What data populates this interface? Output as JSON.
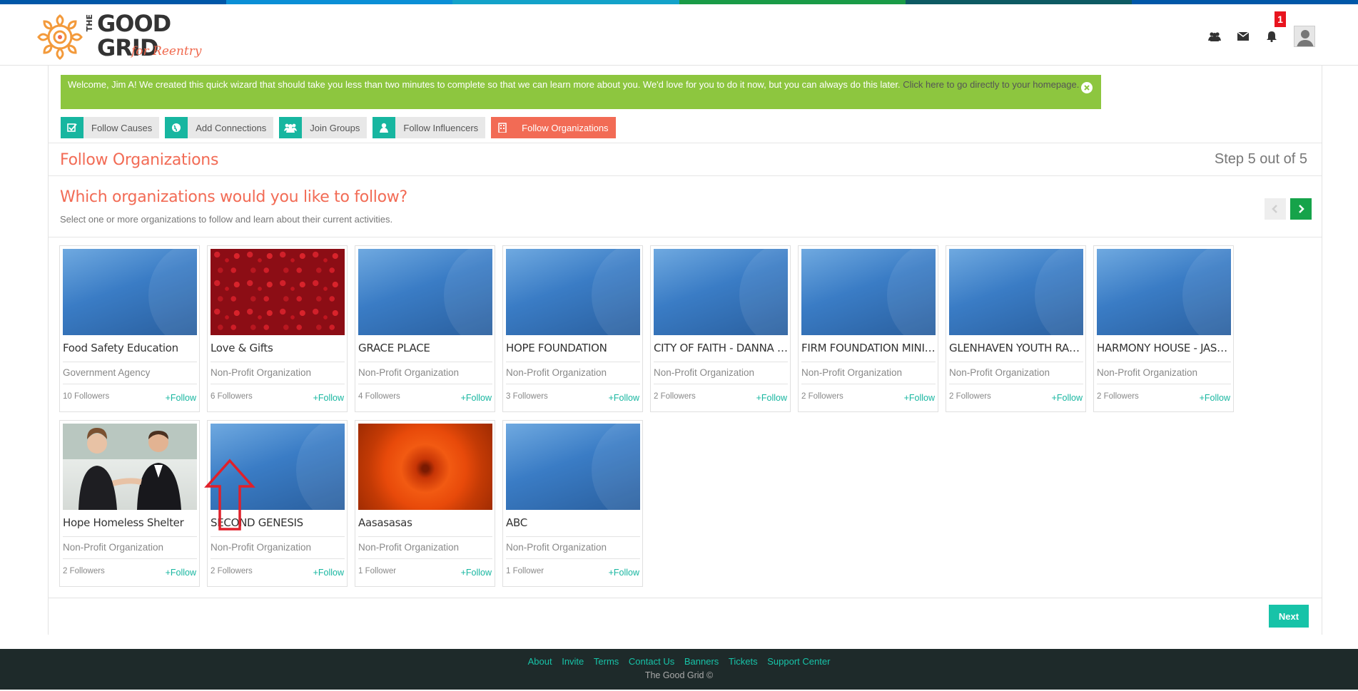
{
  "header": {
    "logo_the": "THE",
    "logo_line1": "GOOD",
    "logo_line2": "GRID",
    "logo_tagline": "for Reentry",
    "notification_count": "1",
    "stripe_colors": [
      "#0057a8",
      "#0a8fd6",
      "#13a2c9",
      "#1a9b47",
      "#0d5a63"
    ]
  },
  "welcome": {
    "message": "Welcome, Jim A! We created this quick wizard that should take you less than two minutes to complete so that we can learn more about you. We'd love for you to do it now, but you can always do this later.",
    "link_text": "Click here to go directly to your homepage."
  },
  "steps": [
    {
      "label": "Follow Causes",
      "icon": "checkbox-icon"
    },
    {
      "label": "Add Connections",
      "icon": "globe-icon"
    },
    {
      "label": "Join Groups",
      "icon": "users-icon"
    },
    {
      "label": "Follow Influencers",
      "icon": "user-icon"
    },
    {
      "label": "Follow Organizations",
      "icon": "building-icon"
    }
  ],
  "section": {
    "title": "Follow Organizations",
    "step_of": "Step 5 out of 5",
    "question": "Which organizations would you like to follow?",
    "subtitle": "Select one or more organizations to follow and learn about their current activities."
  },
  "organizations": [
    {
      "name": "Food Safety Education",
      "type": "Government Agency",
      "followers": "10 Followers",
      "follow": "+Follow"
    },
    {
      "name": "Love & Gifts",
      "type": "Non-Profit Organization",
      "followers": "6 Followers",
      "follow": "+Follow"
    },
    {
      "name": "GRACE PLACE",
      "type": "Non-Profit Organization",
      "followers": "4 Followers",
      "follow": "+Follow"
    },
    {
      "name": "HOPE FOUNDATION",
      "type": "Non-Profit Organization",
      "followers": "3 Followers",
      "follow": "+Follow"
    },
    {
      "name": "CITY OF FAITH - DANNA HO...",
      "type": "Non-Profit Organization",
      "followers": "2 Followers",
      "follow": "+Follow"
    },
    {
      "name": "FIRM FOUNDATION MINIST...",
      "type": "Non-Profit Organization",
      "followers": "2 Followers",
      "follow": "+Follow"
    },
    {
      "name": "GLENHAVEN YOUTH RANCH",
      "type": "Non-Profit Organization",
      "followers": "2 Followers",
      "follow": "+Follow"
    },
    {
      "name": "HARMONY HOUSE - JASPER",
      "type": "Non-Profit Organization",
      "followers": "2 Followers",
      "follow": "+Follow"
    },
    {
      "name": "Hope Homeless Shelter",
      "type": "Non-Profit Organization",
      "followers": "2 Followers",
      "follow": "+Follow"
    },
    {
      "name": "SECOND GENESIS",
      "type": "Non-Profit Organization",
      "followers": "2 Followers",
      "follow": "+Follow"
    },
    {
      "name": "Aasasasas",
      "type": "Non-Profit Organization",
      "followers": "1 Follower",
      "follow": "+Follow"
    },
    {
      "name": "ABC",
      "type": "Non-Profit Organization",
      "followers": "1 Follower",
      "follow": "+Follow"
    }
  ],
  "next_label": "Next",
  "footer": {
    "links": [
      "About",
      "Invite",
      "Terms",
      "Contact Us",
      "Banners",
      "Tickets",
      "Support Center"
    ],
    "copyright": "The Good Grid ©"
  }
}
